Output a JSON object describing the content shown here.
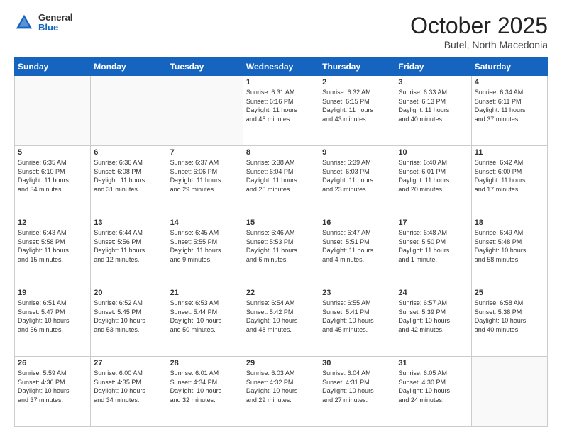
{
  "header": {
    "logo_general": "General",
    "logo_blue": "Blue",
    "month": "October 2025",
    "location": "Butel, North Macedonia"
  },
  "days_of_week": [
    "Sunday",
    "Monday",
    "Tuesday",
    "Wednesday",
    "Thursday",
    "Friday",
    "Saturday"
  ],
  "weeks": [
    [
      {
        "day": "",
        "info": ""
      },
      {
        "day": "",
        "info": ""
      },
      {
        "day": "",
        "info": ""
      },
      {
        "day": "1",
        "info": "Sunrise: 6:31 AM\nSunset: 6:16 PM\nDaylight: 11 hours\nand 45 minutes."
      },
      {
        "day": "2",
        "info": "Sunrise: 6:32 AM\nSunset: 6:15 PM\nDaylight: 11 hours\nand 43 minutes."
      },
      {
        "day": "3",
        "info": "Sunrise: 6:33 AM\nSunset: 6:13 PM\nDaylight: 11 hours\nand 40 minutes."
      },
      {
        "day": "4",
        "info": "Sunrise: 6:34 AM\nSunset: 6:11 PM\nDaylight: 11 hours\nand 37 minutes."
      }
    ],
    [
      {
        "day": "5",
        "info": "Sunrise: 6:35 AM\nSunset: 6:10 PM\nDaylight: 11 hours\nand 34 minutes."
      },
      {
        "day": "6",
        "info": "Sunrise: 6:36 AM\nSunset: 6:08 PM\nDaylight: 11 hours\nand 31 minutes."
      },
      {
        "day": "7",
        "info": "Sunrise: 6:37 AM\nSunset: 6:06 PM\nDaylight: 11 hours\nand 29 minutes."
      },
      {
        "day": "8",
        "info": "Sunrise: 6:38 AM\nSunset: 6:04 PM\nDaylight: 11 hours\nand 26 minutes."
      },
      {
        "day": "9",
        "info": "Sunrise: 6:39 AM\nSunset: 6:03 PM\nDaylight: 11 hours\nand 23 minutes."
      },
      {
        "day": "10",
        "info": "Sunrise: 6:40 AM\nSunset: 6:01 PM\nDaylight: 11 hours\nand 20 minutes."
      },
      {
        "day": "11",
        "info": "Sunrise: 6:42 AM\nSunset: 6:00 PM\nDaylight: 11 hours\nand 17 minutes."
      }
    ],
    [
      {
        "day": "12",
        "info": "Sunrise: 6:43 AM\nSunset: 5:58 PM\nDaylight: 11 hours\nand 15 minutes."
      },
      {
        "day": "13",
        "info": "Sunrise: 6:44 AM\nSunset: 5:56 PM\nDaylight: 11 hours\nand 12 minutes."
      },
      {
        "day": "14",
        "info": "Sunrise: 6:45 AM\nSunset: 5:55 PM\nDaylight: 11 hours\nand 9 minutes."
      },
      {
        "day": "15",
        "info": "Sunrise: 6:46 AM\nSunset: 5:53 PM\nDaylight: 11 hours\nand 6 minutes."
      },
      {
        "day": "16",
        "info": "Sunrise: 6:47 AM\nSunset: 5:51 PM\nDaylight: 11 hours\nand 4 minutes."
      },
      {
        "day": "17",
        "info": "Sunrise: 6:48 AM\nSunset: 5:50 PM\nDaylight: 11 hours\nand 1 minute."
      },
      {
        "day": "18",
        "info": "Sunrise: 6:49 AM\nSunset: 5:48 PM\nDaylight: 10 hours\nand 58 minutes."
      }
    ],
    [
      {
        "day": "19",
        "info": "Sunrise: 6:51 AM\nSunset: 5:47 PM\nDaylight: 10 hours\nand 56 minutes."
      },
      {
        "day": "20",
        "info": "Sunrise: 6:52 AM\nSunset: 5:45 PM\nDaylight: 10 hours\nand 53 minutes."
      },
      {
        "day": "21",
        "info": "Sunrise: 6:53 AM\nSunset: 5:44 PM\nDaylight: 10 hours\nand 50 minutes."
      },
      {
        "day": "22",
        "info": "Sunrise: 6:54 AM\nSunset: 5:42 PM\nDaylight: 10 hours\nand 48 minutes."
      },
      {
        "day": "23",
        "info": "Sunrise: 6:55 AM\nSunset: 5:41 PM\nDaylight: 10 hours\nand 45 minutes."
      },
      {
        "day": "24",
        "info": "Sunrise: 6:57 AM\nSunset: 5:39 PM\nDaylight: 10 hours\nand 42 minutes."
      },
      {
        "day": "25",
        "info": "Sunrise: 6:58 AM\nSunset: 5:38 PM\nDaylight: 10 hours\nand 40 minutes."
      }
    ],
    [
      {
        "day": "26",
        "info": "Sunrise: 5:59 AM\nSunset: 4:36 PM\nDaylight: 10 hours\nand 37 minutes."
      },
      {
        "day": "27",
        "info": "Sunrise: 6:00 AM\nSunset: 4:35 PM\nDaylight: 10 hours\nand 34 minutes."
      },
      {
        "day": "28",
        "info": "Sunrise: 6:01 AM\nSunset: 4:34 PM\nDaylight: 10 hours\nand 32 minutes."
      },
      {
        "day": "29",
        "info": "Sunrise: 6:03 AM\nSunset: 4:32 PM\nDaylight: 10 hours\nand 29 minutes."
      },
      {
        "day": "30",
        "info": "Sunrise: 6:04 AM\nSunset: 4:31 PM\nDaylight: 10 hours\nand 27 minutes."
      },
      {
        "day": "31",
        "info": "Sunrise: 6:05 AM\nSunset: 4:30 PM\nDaylight: 10 hours\nand 24 minutes."
      },
      {
        "day": "",
        "info": ""
      }
    ]
  ]
}
